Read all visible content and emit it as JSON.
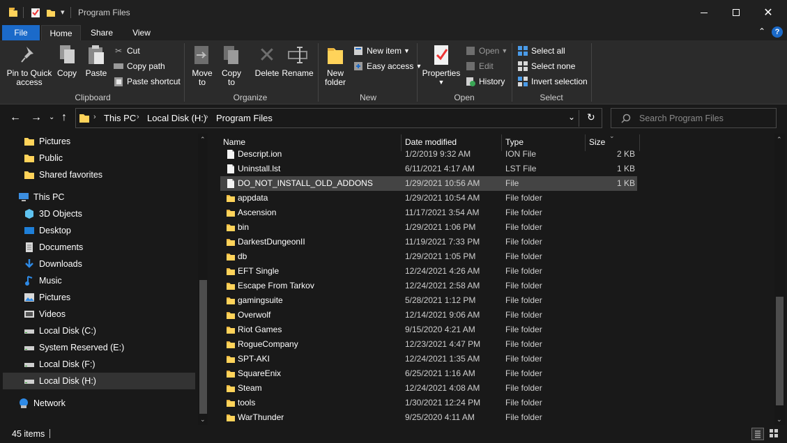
{
  "window": {
    "title": "Program Files",
    "minimize_icon": "minimize-icon",
    "maximize_icon": "maximize-icon",
    "close_icon": "close-icon"
  },
  "ribbon_tabs": [
    "File",
    "Home",
    "Share",
    "View"
  ],
  "ribbon": {
    "clipboard": {
      "label": "Clipboard",
      "pin": "Pin to Quick access",
      "pin_l1": "Pin to Quick",
      "pin_l2": "access",
      "copy": "Copy",
      "paste": "Paste",
      "cut": "Cut",
      "copy_path": "Copy path",
      "paste_shortcut": "Paste shortcut"
    },
    "organize": {
      "label": "Organize",
      "move_l1": "Move",
      "move_l2": "to",
      "copy_l1": "Copy",
      "copy_l2": "to",
      "delete": "Delete",
      "rename": "Rename"
    },
    "new": {
      "label": "New",
      "folder_l1": "New",
      "folder_l2": "folder",
      "new_item": "New item",
      "easy_access": "Easy access"
    },
    "open": {
      "label": "Open",
      "properties": "Properties",
      "open": "Open",
      "edit": "Edit",
      "history": "History"
    },
    "select": {
      "label": "Select",
      "select_all": "Select all",
      "select_none": "Select none",
      "invert": "Invert selection"
    }
  },
  "address": {
    "crumbs": [
      "This PC",
      "Local Disk (H:)",
      "Program Files"
    ],
    "search_placeholder": "Search Program Files"
  },
  "nav_pane": {
    "items": [
      {
        "label": "Pictures",
        "icon": "folder-icon"
      },
      {
        "label": "Public",
        "icon": "folder-icon"
      },
      {
        "label": "Shared favorites",
        "icon": "folder-icon"
      },
      {
        "label": "This PC",
        "icon": "computer-icon"
      },
      {
        "label": "3D Objects",
        "icon": "cube-icon"
      },
      {
        "label": "Desktop",
        "icon": "desktop-icon"
      },
      {
        "label": "Documents",
        "icon": "documents-icon"
      },
      {
        "label": "Downloads",
        "icon": "download-icon"
      },
      {
        "label": "Music",
        "icon": "music-icon"
      },
      {
        "label": "Pictures",
        "icon": "pictures-icon"
      },
      {
        "label": "Videos",
        "icon": "videos-icon"
      },
      {
        "label": "Local Disk (C:)",
        "icon": "drive-icon"
      },
      {
        "label": "System Reserved (E:)",
        "icon": "drive-icon"
      },
      {
        "label": "Local Disk (F:)",
        "icon": "drive-icon"
      },
      {
        "label": "Local Disk (H:)",
        "icon": "drive-icon",
        "selected": true
      },
      {
        "label": "Network",
        "icon": "network-icon"
      }
    ]
  },
  "file_list": {
    "columns": [
      "Name",
      "Date modified",
      "Type",
      "Size"
    ],
    "rows": [
      {
        "name": "Descript.ion",
        "date": "1/2/2019 9:32 AM",
        "type": "ION File",
        "size": "2 KB",
        "kind": "file"
      },
      {
        "name": "Uninstall.lst",
        "date": "6/11/2021 4:17 AM",
        "type": "LST File",
        "size": "1 KB",
        "kind": "file"
      },
      {
        "name": "DO_NOT_INSTALL_OLD_ADDONS",
        "date": "1/29/2021 10:56 AM",
        "type": "File",
        "size": "1 KB",
        "kind": "file",
        "selected": true
      },
      {
        "name": "appdata",
        "date": "1/29/2021 10:54 AM",
        "type": "File folder",
        "size": "",
        "kind": "folder"
      },
      {
        "name": "Ascension",
        "date": "11/17/2021 3:54 AM",
        "type": "File folder",
        "size": "",
        "kind": "folder"
      },
      {
        "name": "bin",
        "date": "1/29/2021 1:06 PM",
        "type": "File folder",
        "size": "",
        "kind": "folder"
      },
      {
        "name": "DarkestDungeonII",
        "date": "11/19/2021 7:33 PM",
        "type": "File folder",
        "size": "",
        "kind": "folder"
      },
      {
        "name": "db",
        "date": "1/29/2021 1:05 PM",
        "type": "File folder",
        "size": "",
        "kind": "folder"
      },
      {
        "name": "EFT Single",
        "date": "12/24/2021 4:26 AM",
        "type": "File folder",
        "size": "",
        "kind": "folder"
      },
      {
        "name": "Escape From Tarkov",
        "date": "12/24/2021 2:58 AM",
        "type": "File folder",
        "size": "",
        "kind": "folder"
      },
      {
        "name": "gamingsuite",
        "date": "5/28/2021 1:12 PM",
        "type": "File folder",
        "size": "",
        "kind": "folder"
      },
      {
        "name": "Overwolf",
        "date": "12/14/2021 9:06 AM",
        "type": "File folder",
        "size": "",
        "kind": "folder"
      },
      {
        "name": "Riot Games",
        "date": "9/15/2020 4:21 AM",
        "type": "File folder",
        "size": "",
        "kind": "folder"
      },
      {
        "name": "RogueCompany",
        "date": "12/23/2021 4:47 PM",
        "type": "File folder",
        "size": "",
        "kind": "folder"
      },
      {
        "name": "SPT-AKI",
        "date": "12/24/2021 1:35 AM",
        "type": "File folder",
        "size": "",
        "kind": "folder"
      },
      {
        "name": "SquareEnix",
        "date": "6/25/2021 1:16 AM",
        "type": "File folder",
        "size": "",
        "kind": "folder"
      },
      {
        "name": "Steam",
        "date": "12/24/2021 4:08 AM",
        "type": "File folder",
        "size": "",
        "kind": "folder"
      },
      {
        "name": "tools",
        "date": "1/30/2021 12:24 PM",
        "type": "File folder",
        "size": "",
        "kind": "folder"
      },
      {
        "name": "WarThunder",
        "date": "9/25/2020 4:11 AM",
        "type": "File folder",
        "size": "",
        "kind": "folder"
      }
    ]
  },
  "status": {
    "item_count": "45 items"
  },
  "colors": {
    "background": "#191919",
    "ribbon": "#2b2b2b",
    "accent": "#1b6ac9",
    "folder": "#ffd35a",
    "selection": "#444444"
  }
}
